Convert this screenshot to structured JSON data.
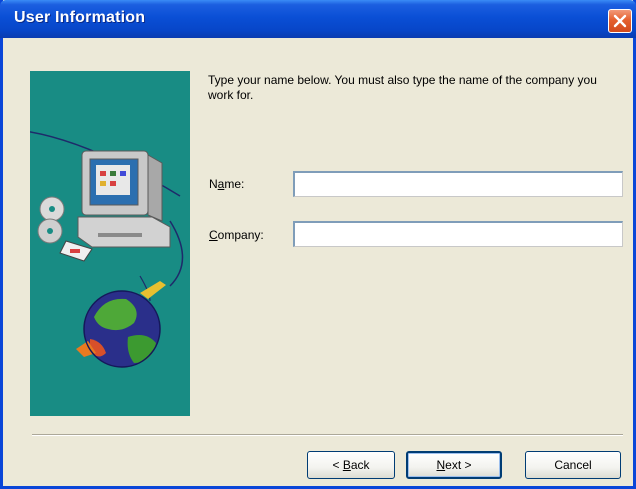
{
  "window": {
    "title": "User Information"
  },
  "content": {
    "instructions": "Type your name below. You must also type the name of the company you work for."
  },
  "form": {
    "name": {
      "label_pre": "N",
      "label_access": "a",
      "label_post": "me:",
      "value": ""
    },
    "company": {
      "label_pre": "",
      "label_access": "C",
      "label_post": "ompany:",
      "value": ""
    }
  },
  "buttons": {
    "back": {
      "pre": "< ",
      "access": "B",
      "post": "ack"
    },
    "next": {
      "pre": "",
      "access": "N",
      "post": "ext >"
    },
    "cancel": {
      "label": "Cancel"
    }
  },
  "icons": {
    "close": "close-icon",
    "illustration": "computer-globe-illustration"
  },
  "colors": {
    "titlebar": "#0a4fd6",
    "close_button": "#e5602e",
    "side_panel": "#188c84",
    "window_background": "#ece9d8"
  }
}
